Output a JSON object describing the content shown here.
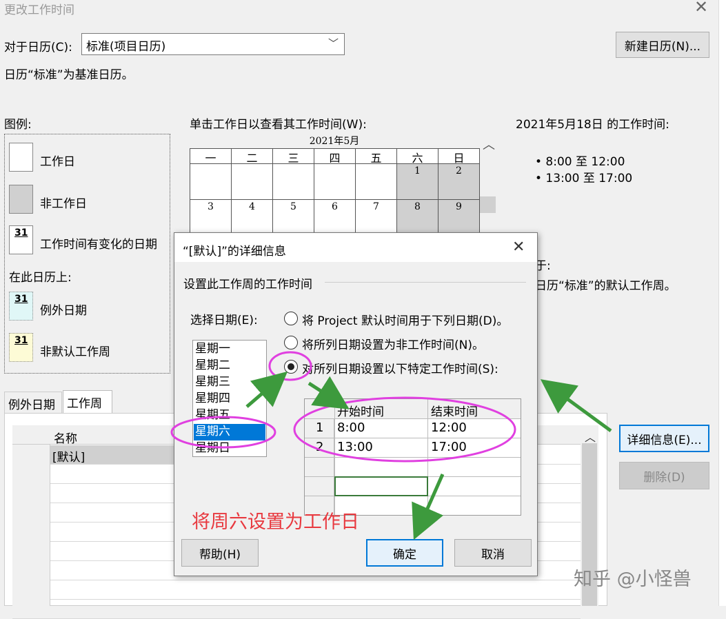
{
  "window": {
    "title": "更改工作时间",
    "close": "✕"
  },
  "calendar_for": {
    "label": "对于日历(C):",
    "value": "标准(项目日历)",
    "new_button": "新建日历(N)..."
  },
  "base_note": "日历“标准”为基准日历。",
  "legend": {
    "title": "图例:",
    "items": [
      {
        "label": "工作日",
        "kind": "work"
      },
      {
        "label": "非工作日",
        "kind": "nonwork"
      },
      {
        "label": "工作时间有变化的日期",
        "kind": "changed",
        "num": "31"
      }
    ],
    "on_calendar_title": "在此日历上:",
    "on_calendar_items": [
      {
        "label": "例外日期",
        "num": "31",
        "color": "#e0f7f7"
      },
      {
        "label": "非默认工作周",
        "num": "31",
        "color": "#fdfbd6"
      }
    ]
  },
  "calendar": {
    "prompt": "单击工作日以查看其工作时间(W):",
    "month": "2021年5月",
    "weekdays": [
      "一",
      "二",
      "三",
      "四",
      "五",
      "六",
      "日"
    ],
    "week1": [
      "",
      "",
      "",
      "",
      "",
      "1",
      "2"
    ],
    "week2": [
      "3",
      "4",
      "5",
      "6",
      "7",
      "8",
      "9"
    ]
  },
  "work_times": {
    "title": "2021年5月18日 的工作时间:",
    "items": [
      "• 8:00 至 12:00",
      "• 13:00 至 17:00"
    ],
    "partial1": "于:",
    "partial2": "日历“标准”的默认工作周。"
  },
  "tabs": [
    "例外日期",
    "工作周"
  ],
  "weeks_table": {
    "col_name": "名称",
    "row_num": "1",
    "row_name": "[默认]"
  },
  "side_buttons": {
    "details": "详细信息(E)...",
    "delete": "删除(D)"
  },
  "dialog": {
    "title": "“[默认]”的详细信息",
    "close": "✕",
    "section": "设置此工作周的工作时间",
    "select_label": "选择日期(E):",
    "days": [
      "星期一",
      "星期二",
      "星期三",
      "星期四",
      "星期五",
      "星期六",
      "星期日"
    ],
    "selected_day_index": 5,
    "options": [
      {
        "label": "将 Project 默认时间用于下列日期(D)。",
        "checked": false
      },
      {
        "label": "将所列日期设置为非工作时间(N)。",
        "checked": false
      },
      {
        "label": "对所列日期设置以下特定工作时间(S):",
        "checked": true
      }
    ],
    "time_table": {
      "col_start": "开始时间",
      "col_end": "结束时间",
      "rows": [
        {
          "num": "1",
          "start": "8:00",
          "end": "12:00"
        },
        {
          "num": "2",
          "start": "13:00",
          "end": "17:00"
        }
      ]
    },
    "help": "帮助(H)",
    "ok": "确定",
    "cancel": "取消"
  },
  "annotation": "将周六设置为工作日",
  "watermark": "知乎 @小怪兽",
  "colors": {
    "annotation_circle": "#e040e0",
    "arrow": "#3d9a3d",
    "selection": "#0078d7",
    "annotation_text": "#e8393f"
  }
}
